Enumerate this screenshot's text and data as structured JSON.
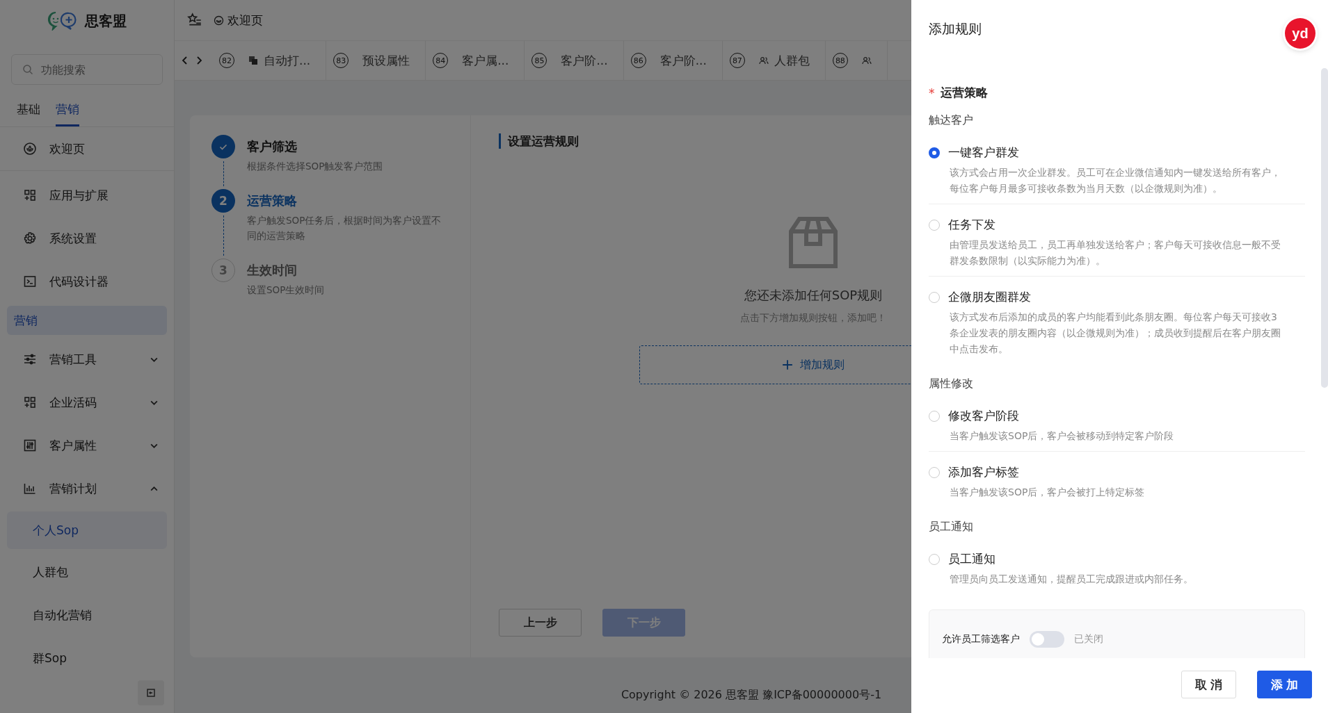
{
  "brand": {
    "name": "思客盟"
  },
  "sidebar": {
    "search": {
      "placeholder": "功能搜索"
    },
    "tabs": [
      {
        "label": "基础",
        "selected": false
      },
      {
        "label": "营销",
        "selected": true
      }
    ],
    "items": [
      {
        "kind": "item",
        "label": "欢迎页"
      },
      {
        "kind": "item",
        "label": "应用与扩展"
      },
      {
        "kind": "item",
        "label": "系统设置"
      },
      {
        "kind": "item",
        "label": "代码设计器"
      },
      {
        "kind": "group",
        "label": "营销"
      },
      {
        "kind": "menu",
        "label": "营销工具",
        "expanded": false
      },
      {
        "kind": "menu",
        "label": "企业活码",
        "expanded": false
      },
      {
        "kind": "menu",
        "label": "客户属性",
        "expanded": false
      },
      {
        "kind": "menu",
        "label": "营销计划",
        "expanded": true,
        "children": [
          {
            "label": "个人Sop",
            "selected": true
          },
          {
            "label": "人群包",
            "selected": false
          },
          {
            "label": "自动化营销",
            "selected": false
          },
          {
            "label": "群Sop",
            "selected": false
          }
        ]
      }
    ]
  },
  "header": {
    "breadcrumb": "欢迎页"
  },
  "tabs": [
    {
      "number": "82",
      "label": "自动打..."
    },
    {
      "number": "83",
      "label": "预设属性"
    },
    {
      "number": "84",
      "label": "客户属..."
    },
    {
      "number": "85",
      "label": "客户阶..."
    },
    {
      "number": "86",
      "label": "客户阶..."
    },
    {
      "number": "87",
      "label": "人群包"
    },
    {
      "number": "88"
    }
  ],
  "steps": [
    {
      "title": "客户筛选",
      "description": "根据条件选择SOP触发客户范围",
      "completed": true,
      "selected": false
    },
    {
      "number": "2",
      "title": "运营策略",
      "description": "客户触发SOP任务后，根据时间为客户设置不同的运营策略",
      "completed": false,
      "selected": true
    },
    {
      "number": "3",
      "title": "生效时间",
      "description": "设置SOP生效时间",
      "completed": false,
      "selected": false
    }
  ],
  "rules": {
    "title": "设置运营规则",
    "empty_title": "您还未添加任何SOP规则",
    "empty_hint": "点击下方增加规则按钮，添加吧！",
    "add_button": "增加规则"
  },
  "nav_buttons": [
    {
      "label": "上一步",
      "kind": "default",
      "disabled": false
    },
    {
      "label": "下一步",
      "kind": "primary",
      "disabled": true
    }
  ],
  "footer": "Copyright © 2026 思客盟 豫ICP备00000000号-1",
  "drawer": {
    "title": "添加规则",
    "badge": "yd",
    "field_label": "运营策略",
    "required_mark": "*",
    "groups": [
      {
        "title": "触达客户",
        "options": [
          {
            "label": "一键客户群发",
            "description": "该方式会占用一次企业群发。员工可在企业微信通知内一键发送给所有客户，每位客户每月最多可接收条数为当月天数（以企微规则为准）。",
            "selected": true
          },
          {
            "label": "任务下发",
            "description": "由管理员发送给员工，员工再单独发送给客户；客户每天可接收信息一般不受群发条数限制（以实际能力为准）。",
            "selected": false
          },
          {
            "label": "企微朋友圈群发",
            "description": "该方式发布后添加的成员的客户均能看到此条朋友圈。每位客户每天可接收3条企业发表的朋友圈内容（以企微规则为准）；成员收到提醒后在客户朋友圈中点击发布。",
            "selected": false
          }
        ]
      },
      {
        "title": "属性修改",
        "options": [
          {
            "label": "修改客户阶段",
            "description": "当客户触发该SOP后，客户会被移动到特定客户阶段",
            "selected": false
          },
          {
            "label": "添加客户标签",
            "description": "当客户触发该SOP后，客户会被打上特定标签",
            "selected": false
          }
        ]
      },
      {
        "title": "员工通知",
        "options": [
          {
            "label": "员工通知",
            "description": "管理员向员工发送通知，提醒员工完成跟进或内部任务。",
            "selected": false
          }
        ]
      }
    ],
    "toggle": {
      "label": "允许员工筛选客户",
      "on": false,
      "status": "已关闭"
    },
    "buttons": [
      {
        "label": "取 消",
        "kind": "default"
      },
      {
        "label": "添 加",
        "kind": "primary"
      }
    ]
  }
}
